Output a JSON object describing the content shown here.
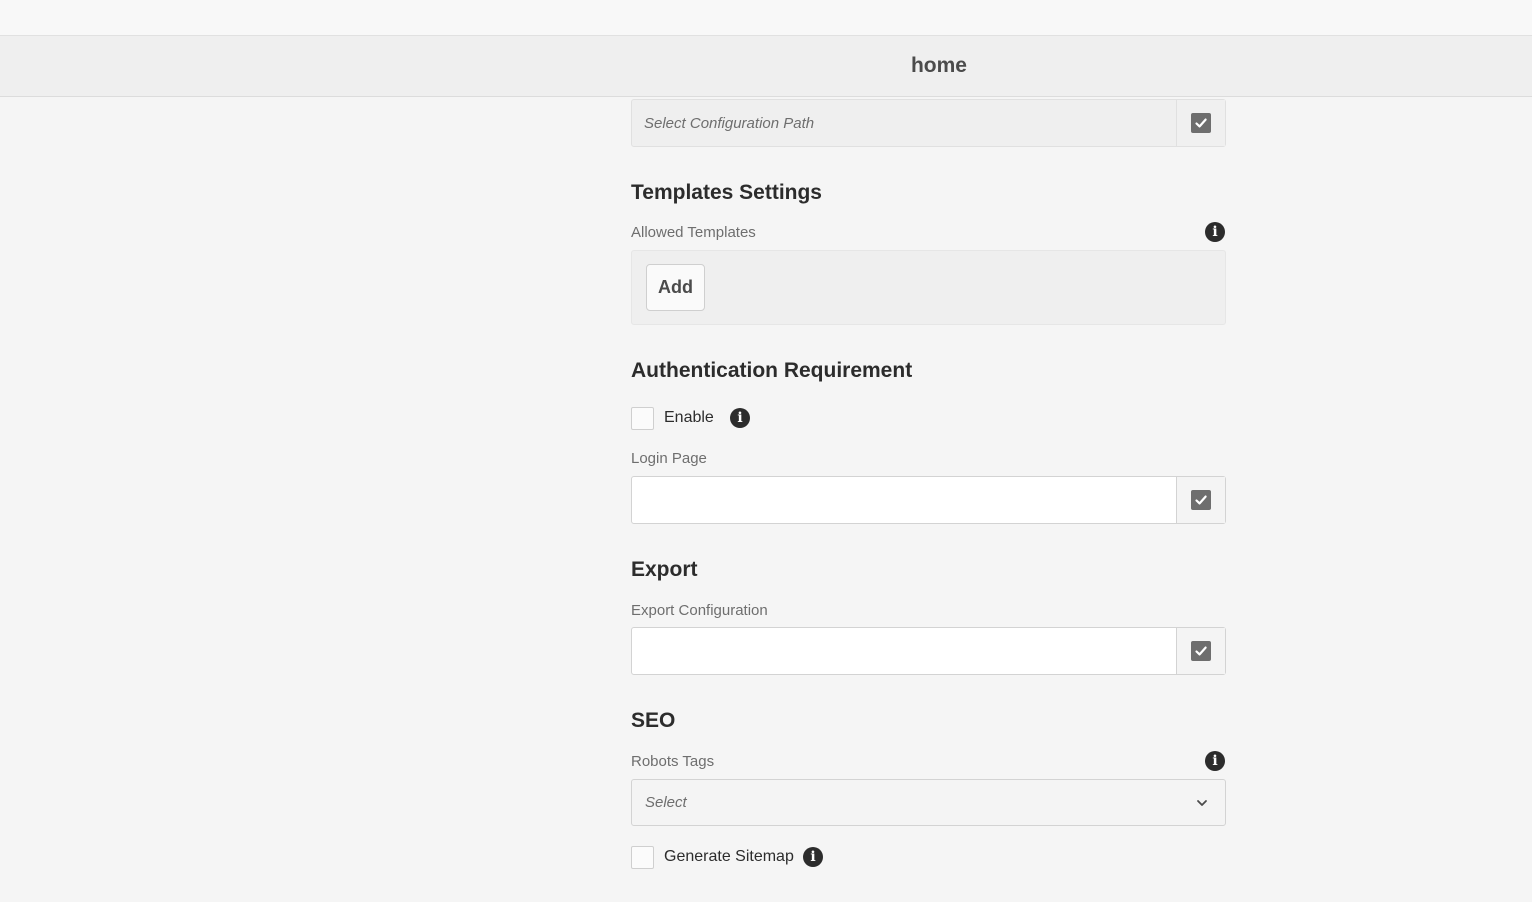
{
  "header": {
    "title": "home"
  },
  "config_path": {
    "placeholder": "Select Configuration Path"
  },
  "templates": {
    "title": "Templates Settings",
    "allowed_label": "Allowed Templates",
    "add_label": "Add"
  },
  "auth": {
    "title": "Authentication Requirement",
    "enable_label": "Enable",
    "enable_checked": false,
    "login_label": "Login Page",
    "login_value": ""
  },
  "export": {
    "title": "Export",
    "config_label": "Export Configuration",
    "config_value": ""
  },
  "seo": {
    "title": "SEO",
    "robots_label": "Robots Tags",
    "robots_selected": "Select",
    "sitemap_label": "Generate Sitemap",
    "sitemap_checked": false
  },
  "icons": {
    "info": "info-icon",
    "picker": "check-square-icon",
    "dropdown": "chevron-down-icon"
  }
}
